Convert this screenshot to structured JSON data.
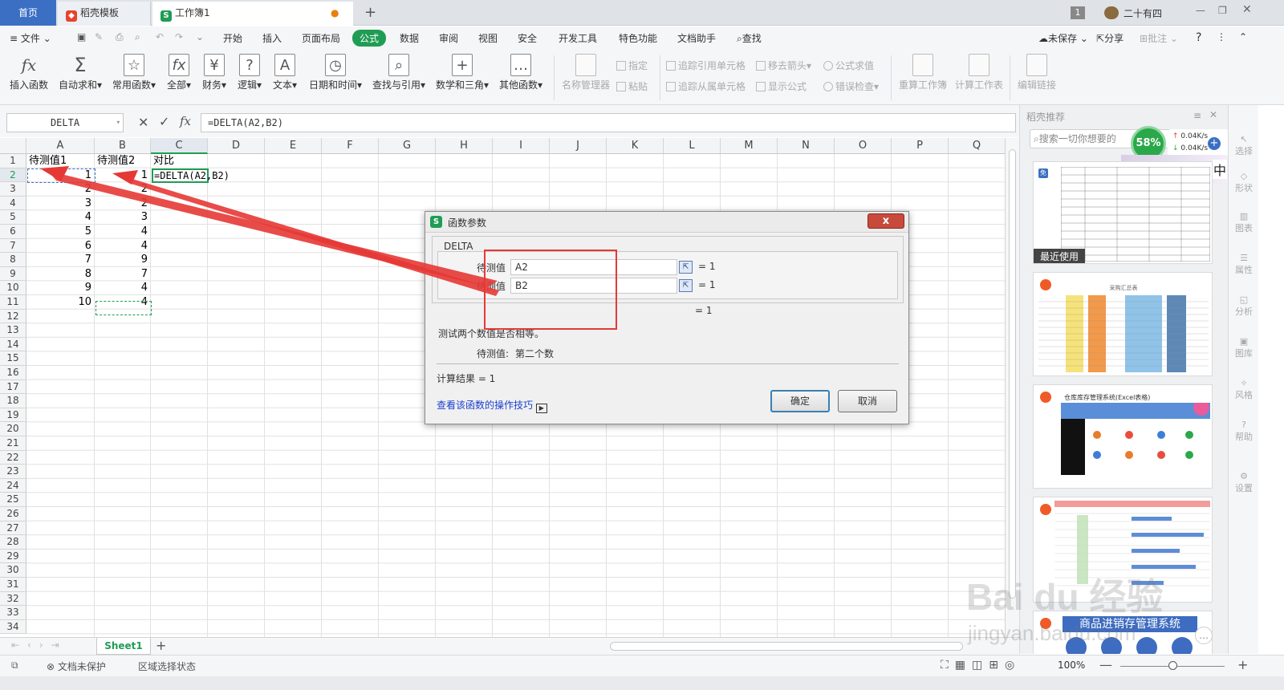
{
  "tabs": {
    "home": "首页",
    "template": "稻壳模板",
    "workbook": "工作簿1",
    "new_tab": "+",
    "page_num": "1",
    "user": "二十有四"
  },
  "menu": {
    "file": "文件",
    "items": [
      "开始",
      "插入",
      "页面布局",
      "公式",
      "数据",
      "审阅",
      "视图",
      "安全",
      "开发工具",
      "特色功能",
      "文档助手"
    ],
    "active": "公式",
    "search": "查找",
    "unsaved": "未保存",
    "share": "分享",
    "comment": "批注",
    "help": "?"
  },
  "ribbon": {
    "main": [
      {
        "label": "插入函数",
        "glyph": "fx"
      },
      {
        "label": "自动求和",
        "glyph": "Σ"
      },
      {
        "label": "常用函数",
        "glyph": "☆"
      },
      {
        "label": "全部",
        "glyph": "fx"
      },
      {
        "label": "财务",
        "glyph": "¥"
      },
      {
        "label": "逻辑",
        "glyph": "?"
      },
      {
        "label": "文本",
        "glyph": "A"
      },
      {
        "label": "日期和时间",
        "glyph": "◷"
      },
      {
        "label": "查找与引用",
        "glyph": "⌕"
      },
      {
        "label": "数学和三角",
        "glyph": "+"
      },
      {
        "label": "其他函数",
        "glyph": "…"
      }
    ],
    "name_manager": "名称管理器",
    "assign": "指定",
    "paste": "粘贴",
    "trace_precedents": "追踪引用单元格",
    "trace_dependents": "追踪从属单元格",
    "remove_arrows": "移去箭头",
    "show_formulas": "显示公式",
    "evaluate": "公式求值",
    "error_check": "错误检查",
    "recalc_book": "重算工作簿",
    "calc_sheet": "计算工作表",
    "edit_links": "编辑链接"
  },
  "formula_bar": {
    "name_box": "DELTA",
    "formula": "=DELTA(A2,B2)",
    "fx": "fx"
  },
  "grid": {
    "columns": [
      "A",
      "B",
      "C",
      "D",
      "E",
      "F",
      "G",
      "H",
      "I",
      "J",
      "K",
      "L",
      "M",
      "N",
      "O",
      "P",
      "Q"
    ],
    "row_count": 34,
    "header_row": [
      "待测值1",
      "待测值2",
      "对比"
    ],
    "col_a": [
      "1",
      "2",
      "3",
      "4",
      "5",
      "6",
      "7",
      "8",
      "9",
      "10"
    ],
    "col_b": [
      "1",
      "2",
      "2",
      "3",
      "4",
      "4",
      "9",
      "7",
      "4",
      "4"
    ],
    "c2": "=DELTA(A2,B2)"
  },
  "dialog": {
    "title": "函数参数",
    "func_name": "DELTA",
    "arg1_label": "待测值",
    "arg1_value": "A2",
    "arg1_result": "= 1",
    "arg2_label": "待测值",
    "arg2_value": "B2",
    "arg2_result": "= 1",
    "total_result": "= 1",
    "description": "测试两个数值是否相等。",
    "arg_desc_label": "待测值:",
    "arg_desc": "第二个数",
    "calc_result": "计算结果  =  1",
    "help_link": "查看该函数的操作技巧",
    "ok": "确定",
    "cancel": "取消",
    "close": "x"
  },
  "side_panel": {
    "title": "稻壳推荐",
    "search_placeholder": "搜索一切你想要的",
    "recent": "最近使用",
    "speed_percent": "58%",
    "speed_up": "0.04K/s",
    "speed_down": "0.04K/s",
    "ime": "中",
    "thumb2_title": "采购汇总表",
    "thumb3_title": "仓库库存管理系统(Excel表格)",
    "thumb5_title": "商品进销存管理系统",
    "strip": [
      "选择",
      "形状",
      "图表",
      "属性",
      "分析",
      "图库",
      "风格",
      "帮助",
      "设置"
    ]
  },
  "sheets": {
    "active": "Sheet1",
    "add": "+"
  },
  "status": {
    "protect": "文档未保护",
    "selection": "区域选择状态",
    "zoom": "100%"
  },
  "watermark": {
    "logo": "Bai du 经验",
    "url": "jingyan.baidu.com"
  },
  "colors": {
    "accent": "#1f9d55",
    "home_tab": "#3b6fc3",
    "red_annotation": "#e53935"
  }
}
